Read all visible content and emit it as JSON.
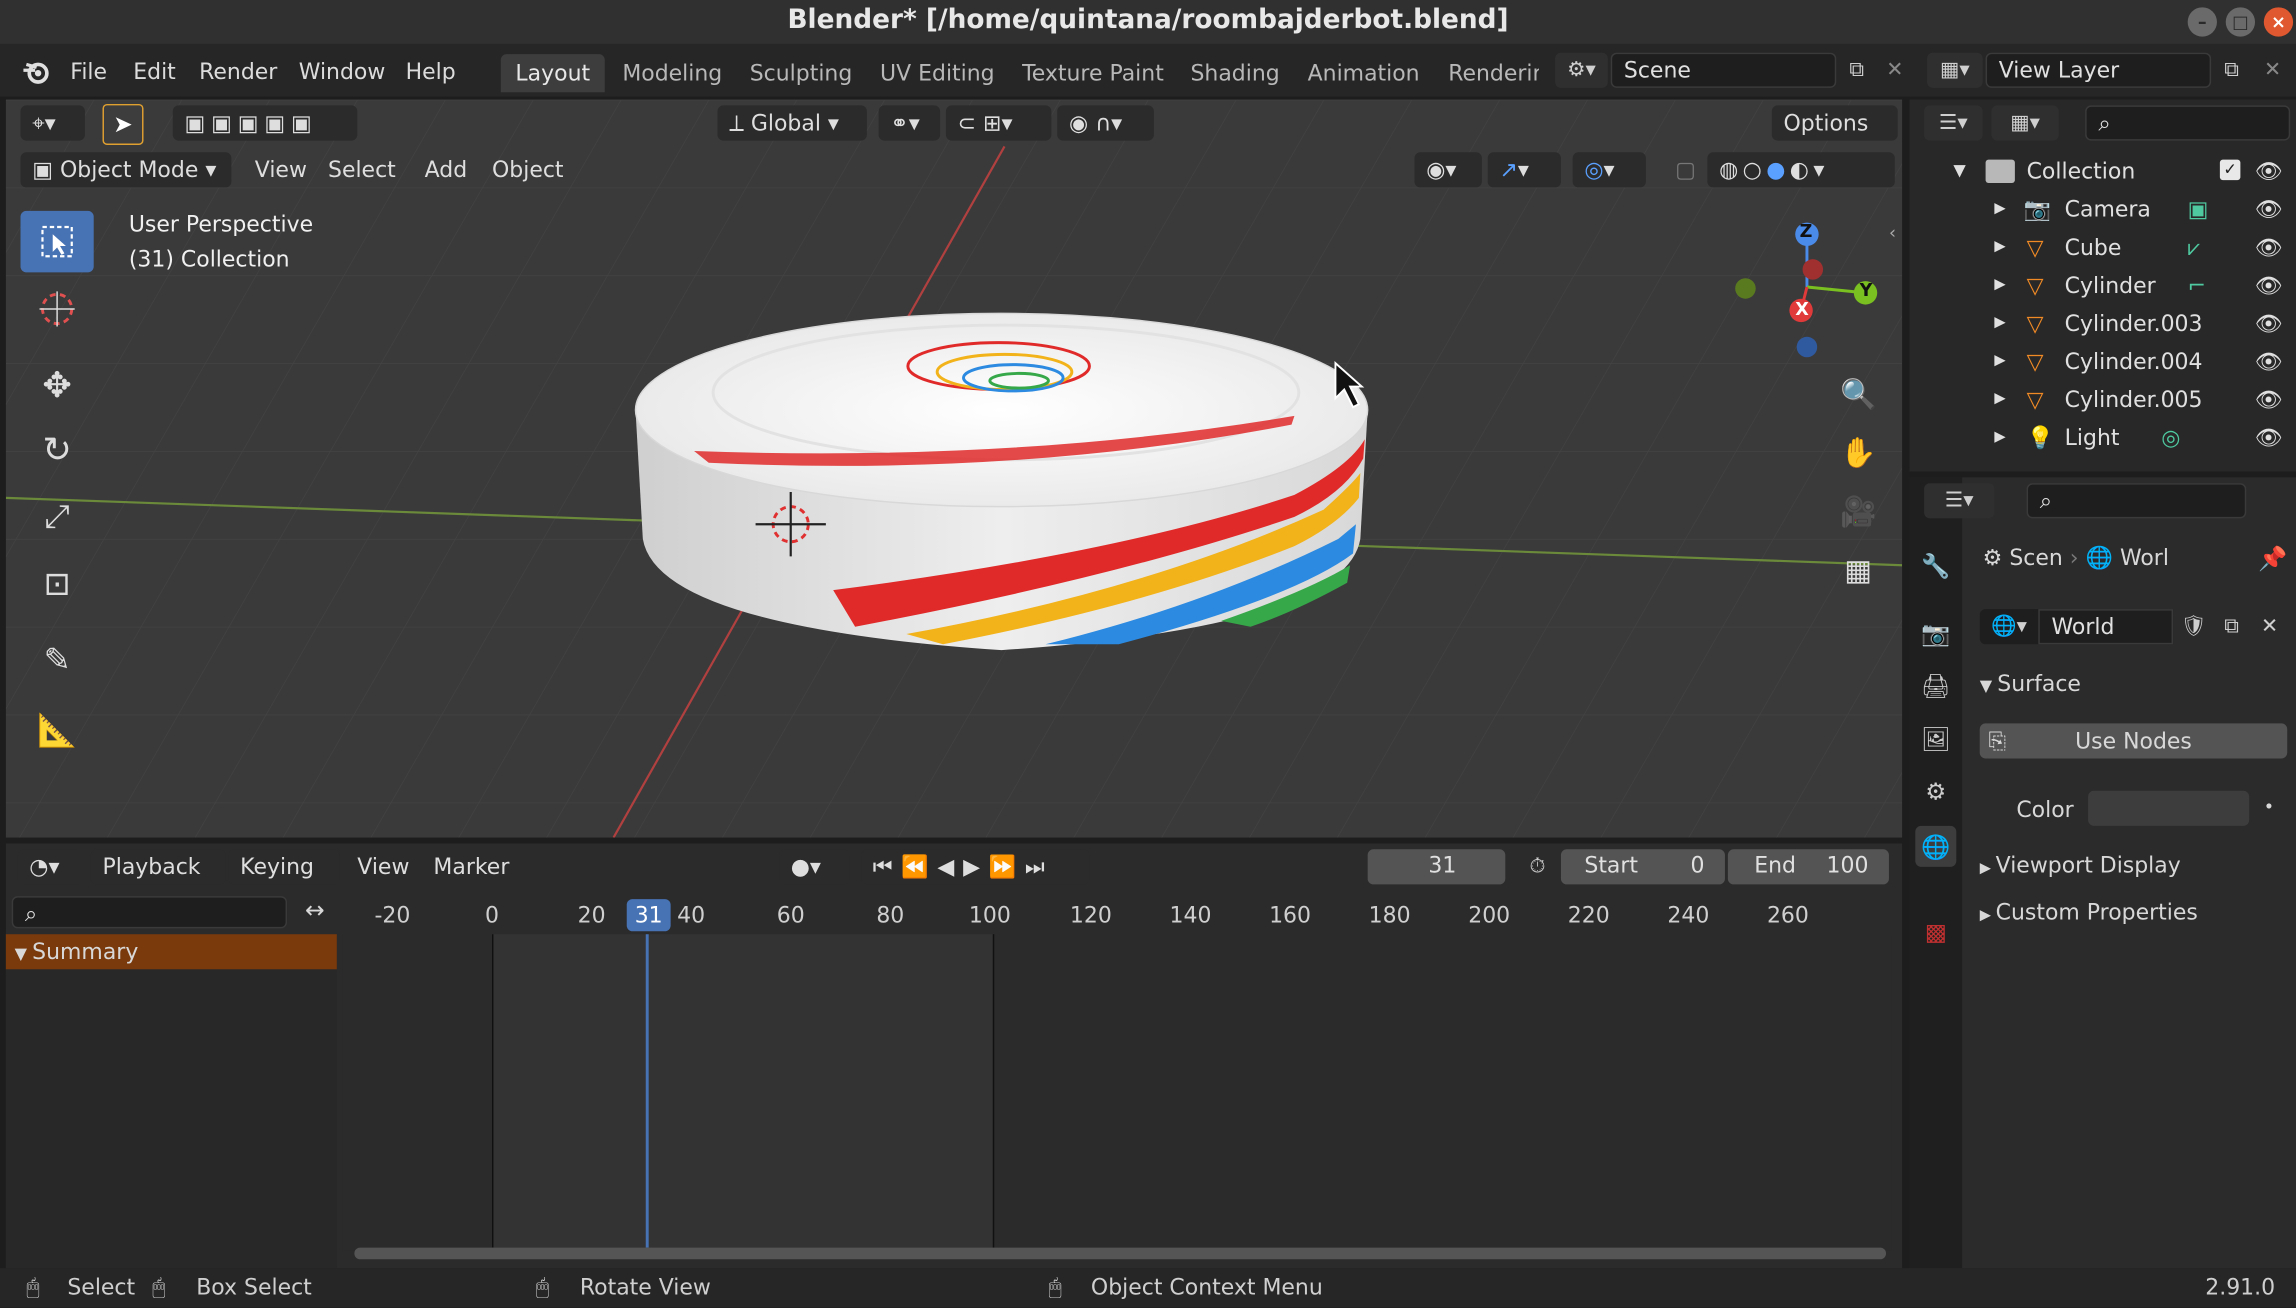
{
  "window": {
    "title": "Blender* [/home/quintana/roombajderbot.blend]"
  },
  "menu": [
    "File",
    "Edit",
    "Render",
    "Window",
    "Help"
  ],
  "workspaces": [
    "Layout",
    "Modeling",
    "Sculpting",
    "UV Editing",
    "Texture Paint",
    "Shading",
    "Animation",
    "Renderir"
  ],
  "scene": {
    "name": "Scene",
    "view_layer": "View Layer"
  },
  "viewport_header": {
    "transform": "Global",
    "options": "Options",
    "mode": "Object Mode",
    "menus": [
      "View",
      "Select",
      "Add",
      "Object"
    ]
  },
  "viewport": {
    "perspective": "User Perspective",
    "collection": "(31) Collection",
    "gizmo": {
      "z": "Z",
      "y": "Y",
      "x": "X"
    }
  },
  "outliner": {
    "collection": "Collection",
    "items": [
      {
        "name": "Camera",
        "type": "camera"
      },
      {
        "name": "Cube",
        "type": "mesh"
      },
      {
        "name": "Cylinder",
        "type": "mesh"
      },
      {
        "name": "Cylinder.003",
        "type": "mesh"
      },
      {
        "name": "Cylinder.004",
        "type": "mesh"
      },
      {
        "name": "Cylinder.005",
        "type": "mesh"
      },
      {
        "name": "Light",
        "type": "light"
      }
    ]
  },
  "properties": {
    "breadcrumb": [
      "Scen",
      "Worl"
    ],
    "world": "World",
    "surface": "Surface",
    "use_nodes": "Use Nodes",
    "color_label": "Color",
    "viewport_display": "Viewport Display",
    "custom_properties": "Custom Properties"
  },
  "timeline": {
    "menus": [
      "Playback",
      "Keying",
      "View",
      "Marker"
    ],
    "current_frame": "31",
    "start_label": "Start",
    "start": "0",
    "end_label": "End",
    "end": "100",
    "ticks": [
      "-20",
      "0",
      "20",
      "40",
      "60",
      "80",
      "100",
      "120",
      "140",
      "160",
      "180",
      "200",
      "220",
      "240",
      "260"
    ],
    "summary": "Summary"
  },
  "status": {
    "select": "Select",
    "box_select": "Box Select",
    "rotate": "Rotate View",
    "context": "Object Context Menu",
    "version": "2.91.0"
  },
  "colors": {
    "accent": "#4772b3",
    "summary": "#7a3a0c",
    "active_orange": "#f08a25"
  }
}
